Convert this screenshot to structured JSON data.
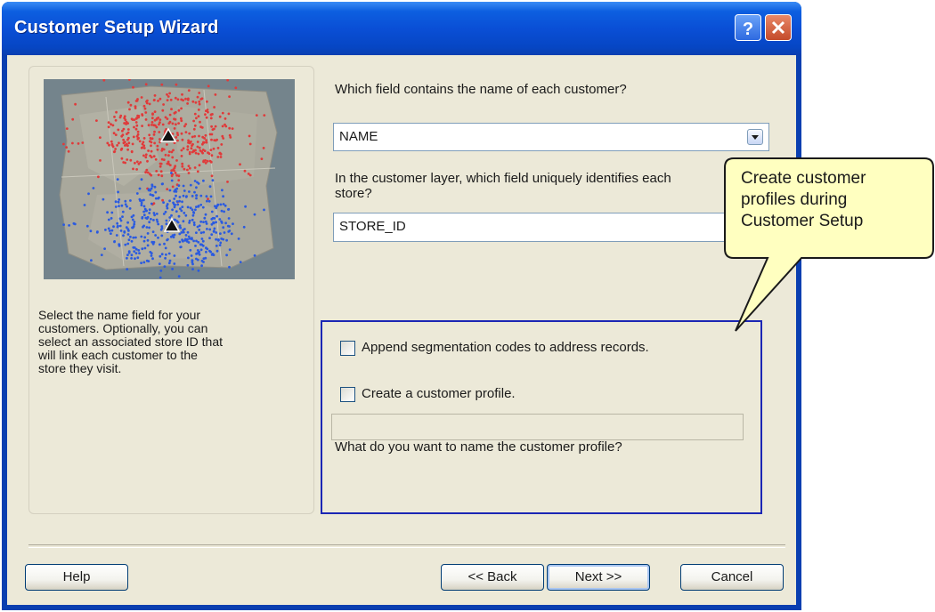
{
  "window": {
    "title": "Customer Setup Wizard"
  },
  "left_panel": {
    "description": "Select the name field for your\ncustomers. Optionally, you can\nselect an associated store ID that\nwill link each customer to the\nstore they visit."
  },
  "form": {
    "name_field_question": "Which field contains the name of each customer?",
    "name_field_value": "NAME",
    "store_field_question": "In the customer layer, which field uniquely identifies each\nstore?",
    "store_field_value": "STORE_ID",
    "append_codes_label": "Append segmentation codes to address records.",
    "append_codes_checked": false,
    "create_profile_label": "Create a customer profile.",
    "create_profile_checked": false,
    "profile_name_question": "What do you want to name the customer profile?",
    "profile_name_value": ""
  },
  "buttons": {
    "help": "Help",
    "back": "<< Back",
    "next": "Next >>",
    "cancel": "Cancel"
  },
  "callout": {
    "text": "Create customer\nprofiles during\nCustomer Setup"
  },
  "colors": {
    "titlebar": "#0a4fd6",
    "highlight_box": "#1b26b4",
    "callout_fill": "#ffffc0",
    "map_red_dots": "#e03a3a",
    "map_blue_dots": "#2a5ae0"
  }
}
